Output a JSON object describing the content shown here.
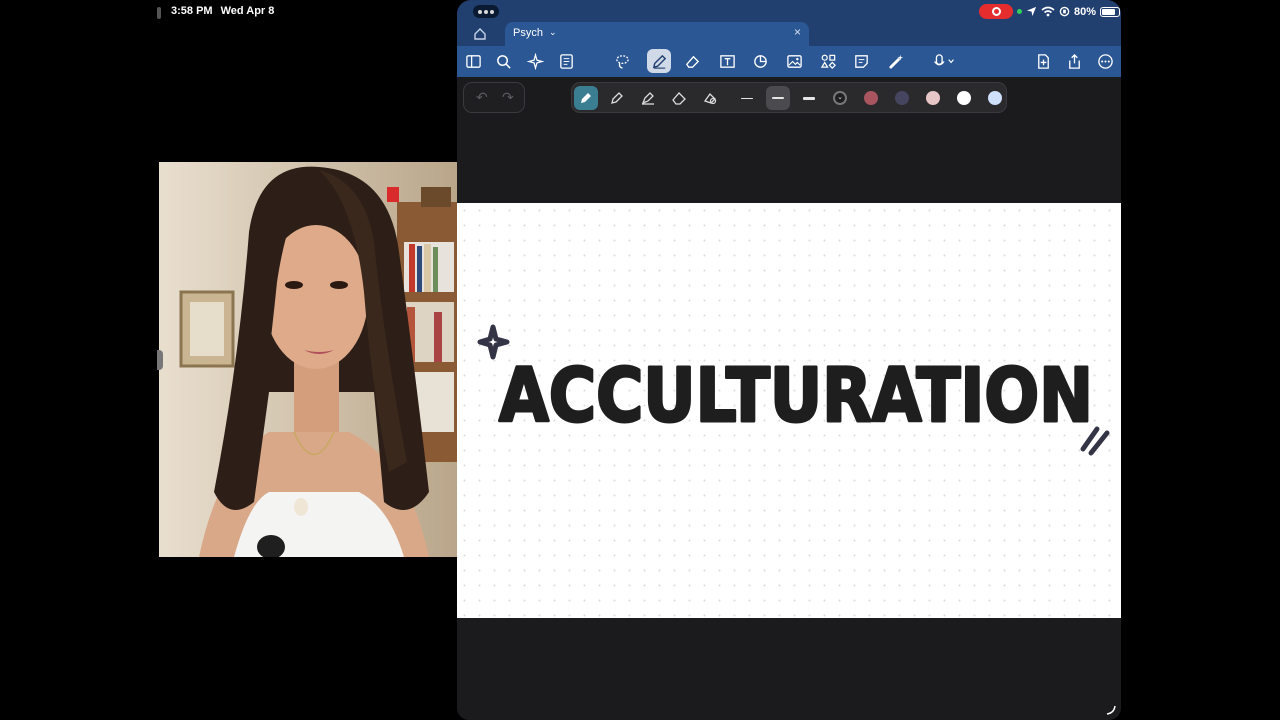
{
  "status_bar": {
    "time": "3:58 PM",
    "date": "Wed Apr 8",
    "battery": "80%"
  },
  "app": {
    "tab": {
      "label": "Psych"
    },
    "toolbar_icons": [
      "book-icon",
      "search-icon",
      "sparkle-icon",
      "document-icon",
      "lasso-icon",
      "pen-icon",
      "eraser-icon",
      "textbox-icon",
      "shapes-icon",
      "image-icon",
      "elements-icon",
      "sticky-note-icon",
      "laser-pointer-icon",
      "microphone-icon",
      "add-page-icon",
      "share-icon",
      "more-icon"
    ],
    "pen_colors": [
      "#222222",
      "#a85560",
      "#45455f",
      "#e7c6c8",
      "#ffffff",
      "#cfe0fb"
    ],
    "accent": "#2b5794"
  },
  "canvas": {
    "handwritten_text": "ACCULTURATION"
  }
}
